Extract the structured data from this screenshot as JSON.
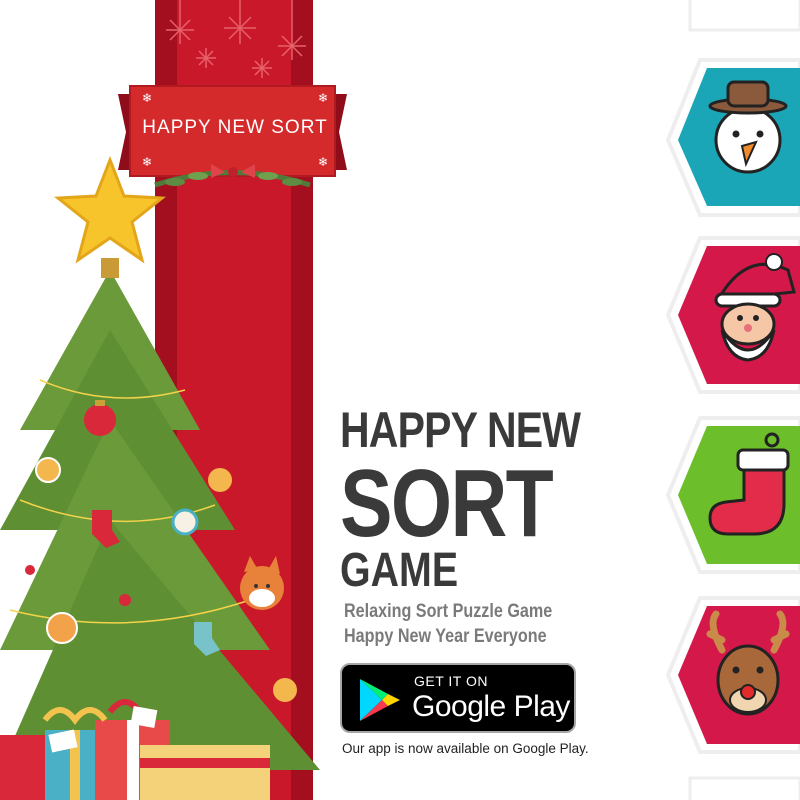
{
  "banner": {
    "text": "HAPPY NEW SORT"
  },
  "title": {
    "line1": "HAPPY NEW",
    "line2": "SORT",
    "line3": "GAME"
  },
  "subtitle": {
    "line1": "Relaxing Sort Puzzle Game",
    "line2": "Happy New Year Everyone"
  },
  "store_button": {
    "small_label": "GET IT ON",
    "big_label": "Google Play"
  },
  "footer": {
    "text": "Our app is now available on Google Play."
  },
  "hex_tiles": [
    {
      "icon": "snowman-icon",
      "color": "#1ba6b8"
    },
    {
      "icon": "santa-icon",
      "color": "#d4194a"
    },
    {
      "icon": "stocking-icon",
      "color": "#6cbf2a"
    },
    {
      "icon": "reindeer-icon",
      "color": "#d4194a"
    }
  ],
  "colors": {
    "ribbon": "#c8182a",
    "ribbon_dark": "#a30f1f",
    "title": "#3a3a3a",
    "subtitle": "#7a7a7a"
  }
}
